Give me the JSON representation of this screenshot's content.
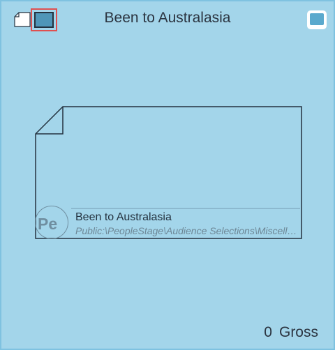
{
  "panel": {
    "title": "Been to Australasia"
  },
  "card": {
    "badge": "Pe",
    "name": "Been to Australasia",
    "path": "Public:\\PeopleStage\\Audience Selections\\Miscellaneous\\Been to Australasia"
  },
  "footer": {
    "count": "0",
    "unit": "Gross"
  },
  "icons": {
    "document": "document-icon",
    "frame": "frame-icon",
    "window": "window-icon"
  },
  "colors": {
    "background": "#a3d5ea",
    "selection_border": "#e05050",
    "frame_fill": "#4f96b8",
    "window_fill": "#5aa9cd"
  }
}
